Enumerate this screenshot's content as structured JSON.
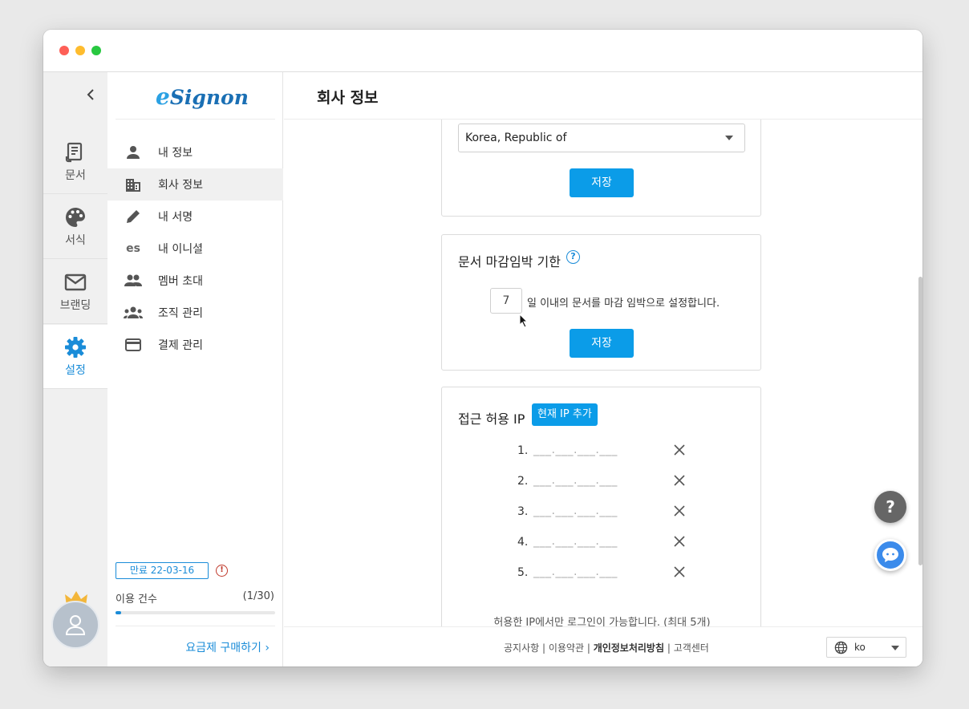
{
  "rail": {
    "items": [
      {
        "label": "문서",
        "icon": "document-icon"
      },
      {
        "label": "서식",
        "icon": "palette-icon"
      },
      {
        "label": "브랜딩",
        "icon": "mail-icon"
      },
      {
        "label": "설정",
        "icon": "gear-icon"
      }
    ]
  },
  "menu": {
    "logo": "eSignon",
    "items": [
      {
        "label": "내 정보",
        "icon": "person-icon"
      },
      {
        "label": "회사 정보",
        "icon": "building-icon"
      },
      {
        "label": "내 서명",
        "icon": "pen-icon"
      },
      {
        "label": "내 이니셜",
        "icon_text": "es"
      },
      {
        "label": "멤버 초대",
        "icon": "group-icon"
      },
      {
        "label": "조직 관리",
        "icon": "organization-icon"
      },
      {
        "label": "결제 관리",
        "icon": "card-icon"
      }
    ],
    "expire": "만료 22-03-16",
    "usage_label": "이용 건수",
    "usage_value": "(1/30)",
    "usage_fraction": 0.033,
    "buy_label": "요금제 구매하기"
  },
  "main": {
    "title": "회사 정보",
    "country_select": "Korea, Republic of",
    "save_label": "저장",
    "deadline": {
      "title": "문서 마감임박 기한",
      "days": "7",
      "suffix": "일 이내의 문서를 마감 임박으로 설정합니다."
    },
    "ip": {
      "title": "접근 허용 IP",
      "add_label": "현재 IP 추가",
      "rows": [
        {
          "num": "1.",
          "placeholder": "___.___.___.___"
        },
        {
          "num": "2.",
          "placeholder": "___.___.___.___"
        },
        {
          "num": "3.",
          "placeholder": "___.___.___.___"
        },
        {
          "num": "4.",
          "placeholder": "___.___.___.___"
        },
        {
          "num": "5.",
          "placeholder": "___.___.___.___"
        }
      ],
      "note": "허용한 IP에서만 로그인이 가능합니다. (최대 5개)"
    }
  },
  "footer": {
    "notice": "공지사항",
    "terms": "이용약관",
    "privacy": "개인정보처리방침",
    "support": "고객센터",
    "lang": "ko"
  },
  "colors": {
    "accent": "#1a8cd8",
    "button": "#0b9ce8"
  }
}
